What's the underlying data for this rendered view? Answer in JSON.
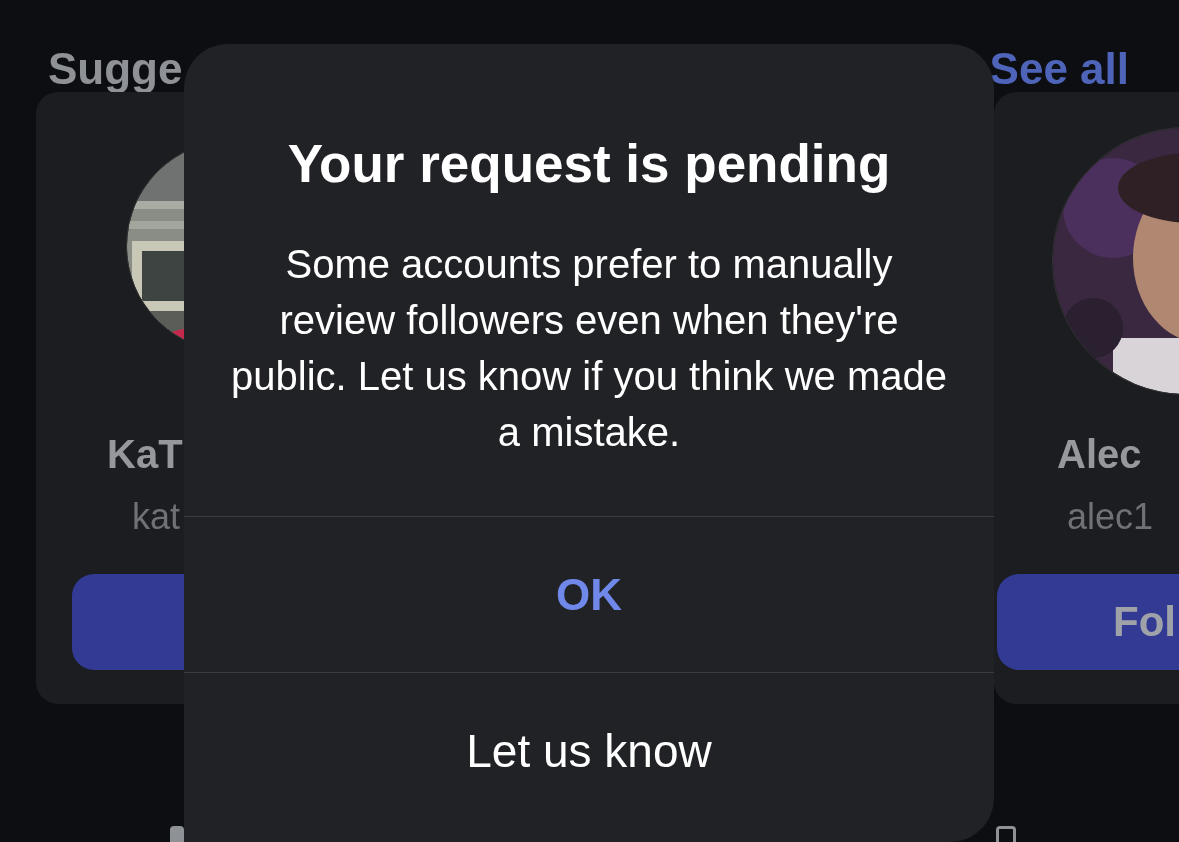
{
  "section": {
    "title": "Sugge",
    "link": "See all"
  },
  "suggestions": [
    {
      "name": "KaT",
      "username": "kat"
    },
    {
      "name": "Alec",
      "username": "alec1",
      "button": "Fol"
    }
  ],
  "dialog": {
    "title": "Your request is pending",
    "message": "Some accounts prefer to manually review followers even when they're public. Let us know if you think we made a mistake.",
    "actions": [
      {
        "label": "OK",
        "kind": "primary"
      },
      {
        "label": "Let us know",
        "kind": "default"
      }
    ]
  }
}
